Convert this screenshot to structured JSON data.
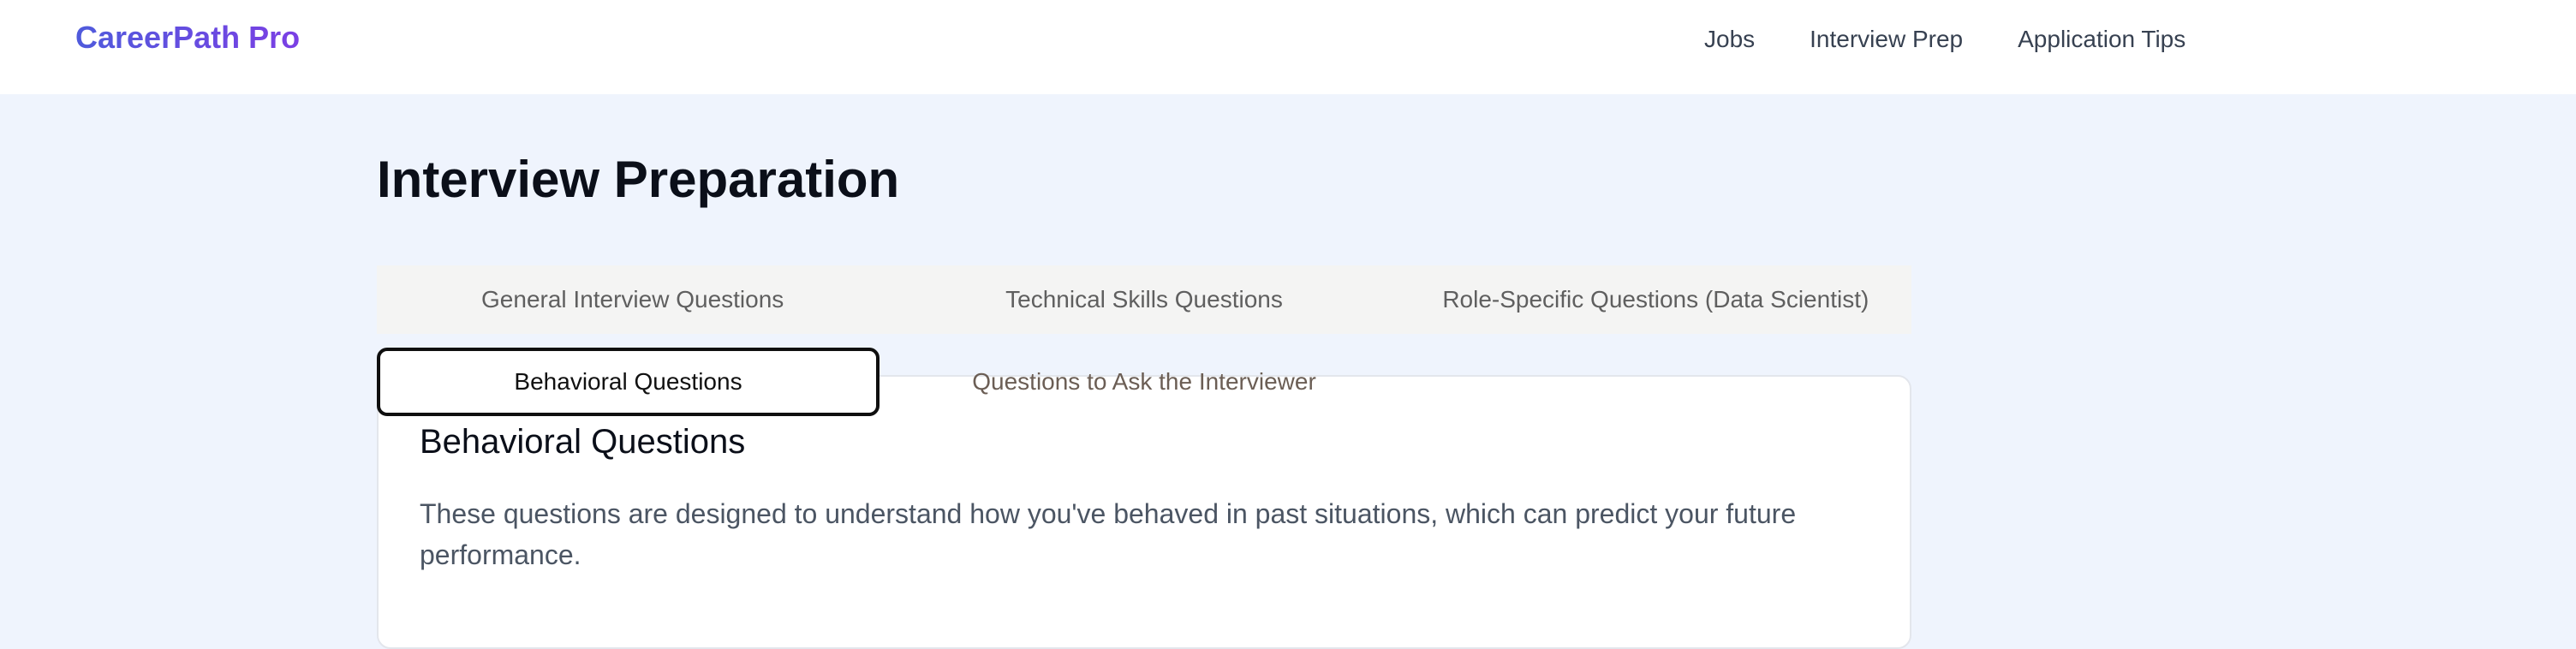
{
  "header": {
    "brand": "CareerPath Pro",
    "nav": [
      "Jobs",
      "Interview Prep",
      "Application Tips"
    ]
  },
  "page": {
    "title": "Interview Preparation"
  },
  "tabs": {
    "row1": [
      "General Interview Questions",
      "Technical Skills Questions",
      "Role-Specific Questions (Data Scientist)"
    ],
    "active": "Behavioral Questions",
    "inactive": "Questions to Ask the Interviewer"
  },
  "content": {
    "title": "Behavioral Questions",
    "description": "These questions are designed to understand how you've behaved in past situations, which can predict your future performance."
  },
  "colors": {
    "page_background": "#eff4fd",
    "brand_gradient_start": "#4f5bdc",
    "brand_gradient_end": "#7b3fe4",
    "tab_strip": "#f4f4f3",
    "active_tab_border": "#0f0f0f"
  }
}
